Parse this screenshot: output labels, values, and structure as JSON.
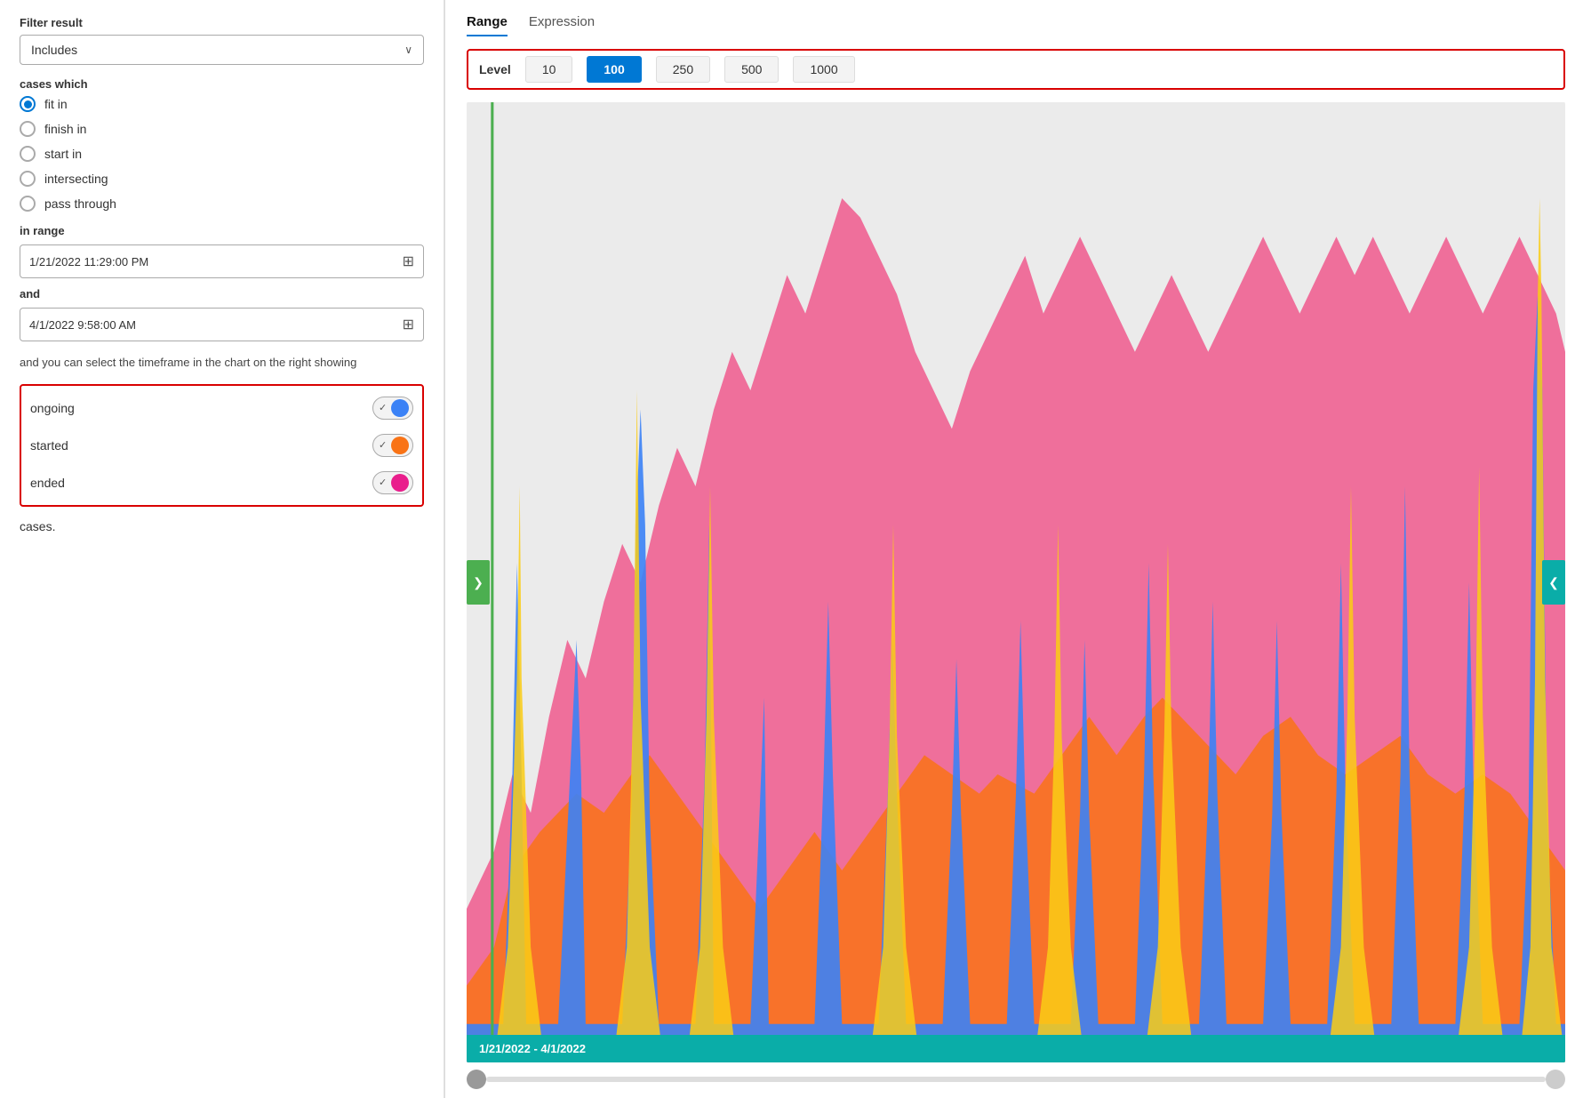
{
  "left": {
    "filter_result_label": "Filter result",
    "dropdown": {
      "value": "Includes",
      "chevron": "∨"
    },
    "cases_which_label": "cases which",
    "radio_options": [
      {
        "id": "fit_in",
        "label": "fit in",
        "selected": true
      },
      {
        "id": "finish_in",
        "label": "finish in",
        "selected": false
      },
      {
        "id": "start_in",
        "label": "start in",
        "selected": false
      },
      {
        "id": "intersecting",
        "label": "intersecting",
        "selected": false
      },
      {
        "id": "pass_through",
        "label": "pass through",
        "selected": false
      }
    ],
    "in_range_label": "in range",
    "range_start": "1/21/2022 11:29:00 PM",
    "and_label": "and",
    "range_end": "4/1/2022 9:58:00 AM",
    "description": "and you can select the timeframe in the chart on the right showing",
    "toggles": [
      {
        "id": "ongoing",
        "label": "ongoing",
        "enabled": true,
        "color": "#3b82f6"
      },
      {
        "id": "started",
        "label": "started",
        "enabled": true,
        "color": "#f97316"
      },
      {
        "id": "ended",
        "label": "ended",
        "enabled": true,
        "color": "#e91e8c"
      }
    ],
    "cases_text": "cases."
  },
  "right": {
    "tabs": [
      {
        "id": "range",
        "label": "Range",
        "active": true
      },
      {
        "id": "expression",
        "label": "Expression",
        "active": false
      }
    ],
    "level_label": "Level",
    "level_options": [
      {
        "value": "10",
        "active": false
      },
      {
        "value": "100",
        "active": true
      },
      {
        "value": "250",
        "active": false
      },
      {
        "value": "500",
        "active": false
      },
      {
        "value": "1000",
        "active": false
      }
    ],
    "date_range_label": "1/21/2022 - 4/1/2022",
    "nav_left": "❯",
    "nav_right": "❮"
  }
}
